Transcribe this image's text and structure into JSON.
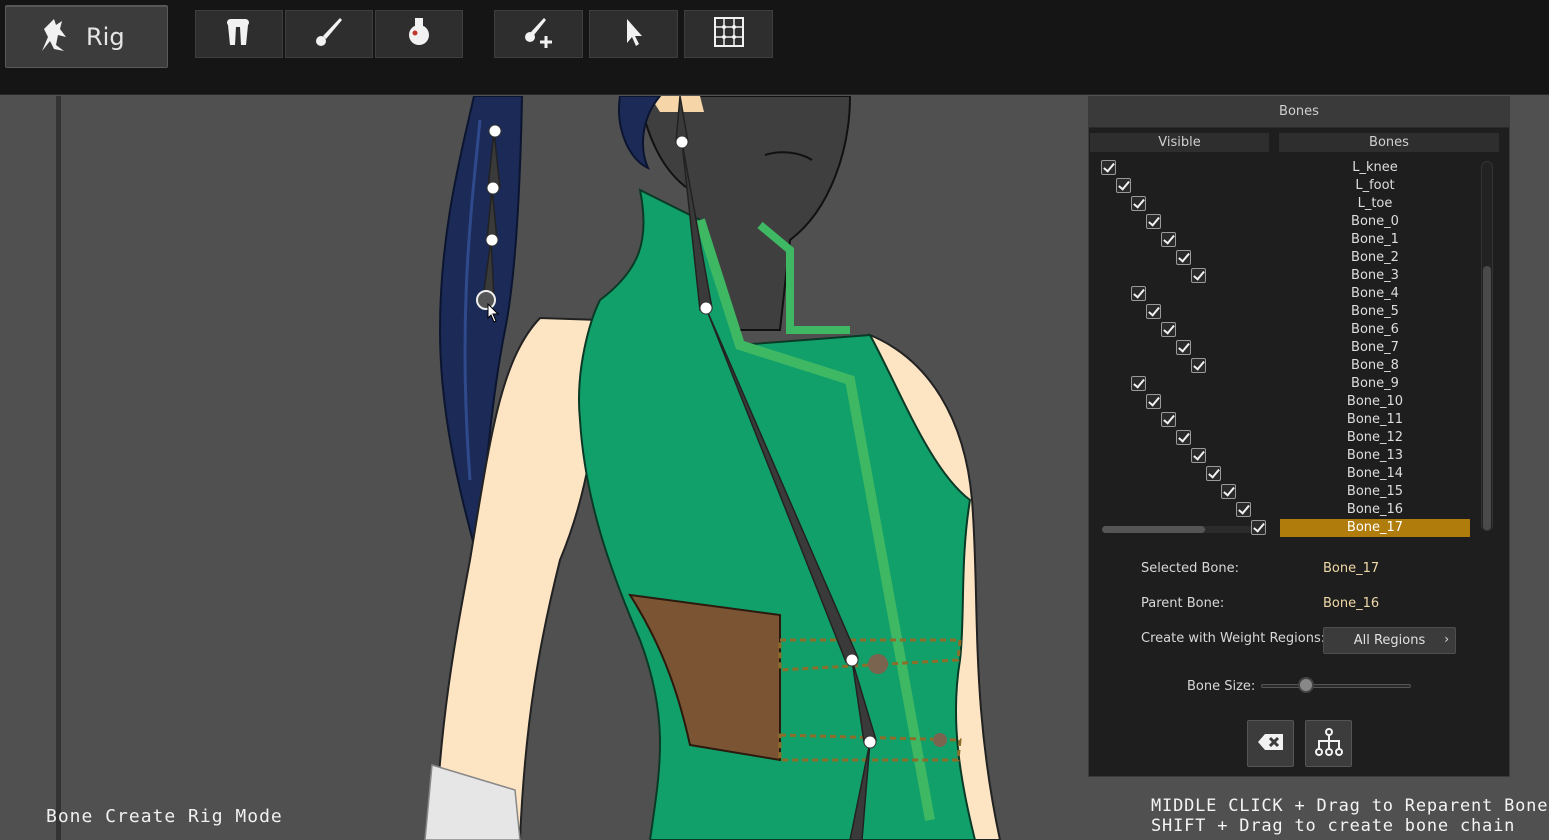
{
  "toolbar": {
    "mode_button": {
      "label": "Rig",
      "icon": "rig-figure-icon"
    },
    "tools": [
      {
        "name": "bone-icon"
      },
      {
        "name": "brush-icon"
      },
      {
        "name": "weight-bulb-icon"
      },
      {
        "name": "add-bone-icon"
      },
      {
        "name": "select-arrow-icon"
      },
      {
        "name": "grid-mesh-icon"
      }
    ]
  },
  "viewport": {
    "mode_label": "Bone Create Rig Mode",
    "hints": [
      "MIDDLE CLICK + Drag to Reparent Bone",
      "SHIFT + Drag to create bone chain"
    ]
  },
  "panel": {
    "title": "Bones",
    "col_visible": "Visible",
    "col_bones": "Bones",
    "bones": [
      {
        "name": "L_knee",
        "depth": 0,
        "visible": true
      },
      {
        "name": "L_foot",
        "depth": 1,
        "visible": true
      },
      {
        "name": "L_toe",
        "depth": 2,
        "visible": true
      },
      {
        "name": "Bone_0",
        "depth": 3,
        "visible": true
      },
      {
        "name": "Bone_1",
        "depth": 4,
        "visible": true
      },
      {
        "name": "Bone_2",
        "depth": 5,
        "visible": true
      },
      {
        "name": "Bone_3",
        "depth": 6,
        "visible": true
      },
      {
        "name": "Bone_4",
        "depth": 2,
        "visible": true
      },
      {
        "name": "Bone_5",
        "depth": 3,
        "visible": true
      },
      {
        "name": "Bone_6",
        "depth": 4,
        "visible": true
      },
      {
        "name": "Bone_7",
        "depth": 5,
        "visible": true
      },
      {
        "name": "Bone_8",
        "depth": 6,
        "visible": true
      },
      {
        "name": "Bone_9",
        "depth": 2,
        "visible": true
      },
      {
        "name": "Bone_10",
        "depth": 3,
        "visible": true
      },
      {
        "name": "Bone_11",
        "depth": 4,
        "visible": true
      },
      {
        "name": "Bone_12",
        "depth": 5,
        "visible": true
      },
      {
        "name": "Bone_13",
        "depth": 6,
        "visible": true
      },
      {
        "name": "Bone_14",
        "depth": 7,
        "visible": true
      },
      {
        "name": "Bone_15",
        "depth": 8,
        "visible": true
      },
      {
        "name": "Bone_16",
        "depth": 9,
        "visible": true
      },
      {
        "name": "Bone_17",
        "depth": 10,
        "visible": true,
        "selected": true
      }
    ],
    "selected_bone_label": "Selected Bone:",
    "selected_bone_value": "Bone_17",
    "parent_bone_label": "Parent Bone:",
    "parent_bone_value": "Bone_16",
    "weight_regions_label": "Create with Weight Regions:",
    "weight_regions_value": "All Regions",
    "bone_size_label": "Bone Size:",
    "bone_size_level": 0.3,
    "delete_icon": "delete-bone-icon",
    "hierarchy_icon": "hierarchy-icon",
    "selection_color": "#b07d0d"
  }
}
